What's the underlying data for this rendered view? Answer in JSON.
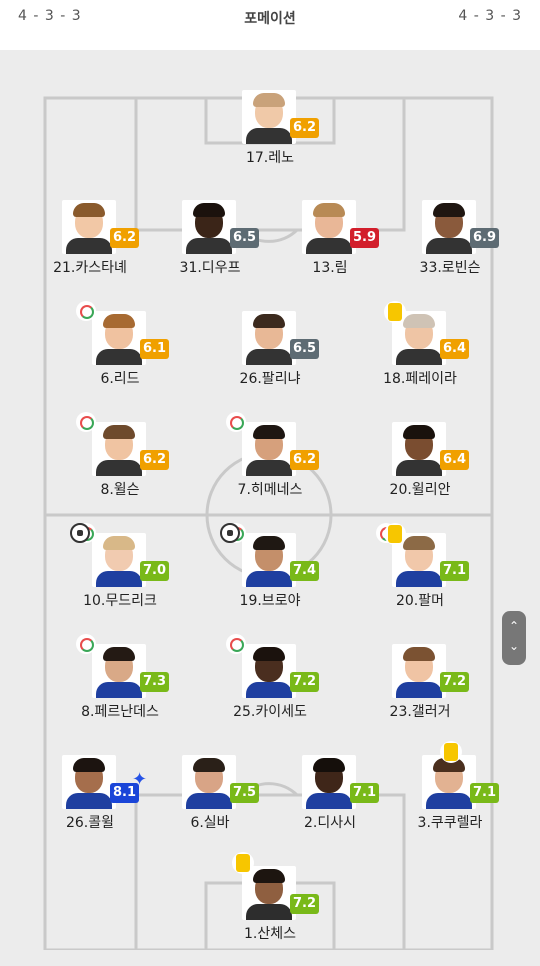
{
  "header": {
    "home_formation": "4 - 3 - 3",
    "title": "포메이션",
    "away_formation": "4 - 3 - 3"
  },
  "colors": {
    "orange": "#f0a000",
    "gray": "#5d6b73",
    "red": "#d21e2b",
    "green": "#79b919",
    "blue": "#1a45d8"
  },
  "players": [
    {
      "name": "17.레노",
      "rating": "6.2",
      "color": "orange",
      "skin": "#f0c9a8",
      "hair": "#c9a27a",
      "shirt": "#333333"
    },
    {
      "name": "21.카스타녜",
      "rating": "6.2",
      "color": "orange",
      "skin": "#f2c8a6",
      "hair": "#8a5a2c",
      "shirt": "#333333"
    },
    {
      "name": "31.디우프",
      "rating": "6.5",
      "color": "gray",
      "skin": "#3b2518",
      "hair": "#1b120d",
      "shirt": "#333333"
    },
    {
      "name": "13.림",
      "rating": "5.9",
      "color": "red",
      "skin": "#e9b797",
      "hair": "#b88a55",
      "shirt": "#333333"
    },
    {
      "name": "33.로빈슨",
      "rating": "6.9",
      "color": "gray",
      "skin": "#8a5a3c",
      "hair": "#1f1611",
      "shirt": "#333333"
    },
    {
      "name": "6.리드",
      "rating": "6.1",
      "color": "orange",
      "skin": "#f0c2a0",
      "hair": "#a76a32",
      "shirt": "#333333"
    },
    {
      "name": "26.팔리냐",
      "rating": "6.5",
      "color": "gray",
      "skin": "#e8b896",
      "hair": "#3c2a1e",
      "shirt": "#333333"
    },
    {
      "name": "18.페레이라",
      "rating": "6.4",
      "color": "orange",
      "skin": "#efc5a5",
      "hair": "#cfc3b5",
      "shirt": "#333333"
    },
    {
      "name": "8.윌슨",
      "rating": "6.2",
      "color": "orange",
      "skin": "#f0c4a2",
      "hair": "#6e4a2c",
      "shirt": "#333333"
    },
    {
      "name": "7.히메네스",
      "rating": "6.2",
      "color": "orange",
      "skin": "#d6a07c",
      "hair": "#1e1612",
      "shirt": "#333333"
    },
    {
      "name": "20.윌리안",
      "rating": "6.4",
      "color": "orange",
      "skin": "#7a4d30",
      "hair": "#1a120d",
      "shirt": "#333333"
    },
    {
      "name": "10.무드리크",
      "rating": "7.0",
      "color": "green",
      "skin": "#f1cbb0",
      "hair": "#d8b888",
      "shirt": "#1f3fa0"
    },
    {
      "name": "19.브로야",
      "rating": "7.4",
      "color": "green",
      "skin": "#c48f6a",
      "hair": "#1f1813",
      "shirt": "#1f3fa0"
    },
    {
      "name": "20.팔머",
      "rating": "7.1",
      "color": "green",
      "skin": "#f1c8aa",
      "hair": "#8c6a46",
      "shirt": "#1f3fa0"
    },
    {
      "name": "8.페르난데스",
      "rating": "7.3",
      "color": "green",
      "skin": "#d9a987",
      "hair": "#241a14",
      "shirt": "#1f3fa0"
    },
    {
      "name": "25.카이세도",
      "rating": "7.2",
      "color": "green",
      "skin": "#4a2e1f",
      "hair": "#1b120d",
      "shirt": "#1f3fa0"
    },
    {
      "name": "23.갤러거",
      "rating": "7.2",
      "color": "green",
      "skin": "#f0c4a4",
      "hair": "#7b5232",
      "shirt": "#1f3fa0"
    },
    {
      "name": "26.콜윌",
      "rating": "8.1",
      "color": "blue",
      "skin": "#a56e4c",
      "hair": "#1c1410",
      "shirt": "#1f3fa0"
    },
    {
      "name": "6.실바",
      "rating": "7.5",
      "color": "green",
      "skin": "#d8a486",
      "hair": "#2a2018",
      "shirt": "#1f3fa0"
    },
    {
      "name": "2.디사시",
      "rating": "7.1",
      "color": "green",
      "skin": "#3f2619",
      "hair": "#150f0b",
      "shirt": "#1f3fa0"
    },
    {
      "name": "3.쿠쿠렐라",
      "rating": "7.1",
      "color": "green",
      "skin": "#e2b292",
      "hair": "#4a2f1e",
      "shirt": "#1f3fa0"
    },
    {
      "name": "1.산체스",
      "rating": "7.2",
      "color": "green",
      "skin": "#8f5f40",
      "hair": "#1d1510",
      "shirt": "#2d2d2d"
    }
  ]
}
